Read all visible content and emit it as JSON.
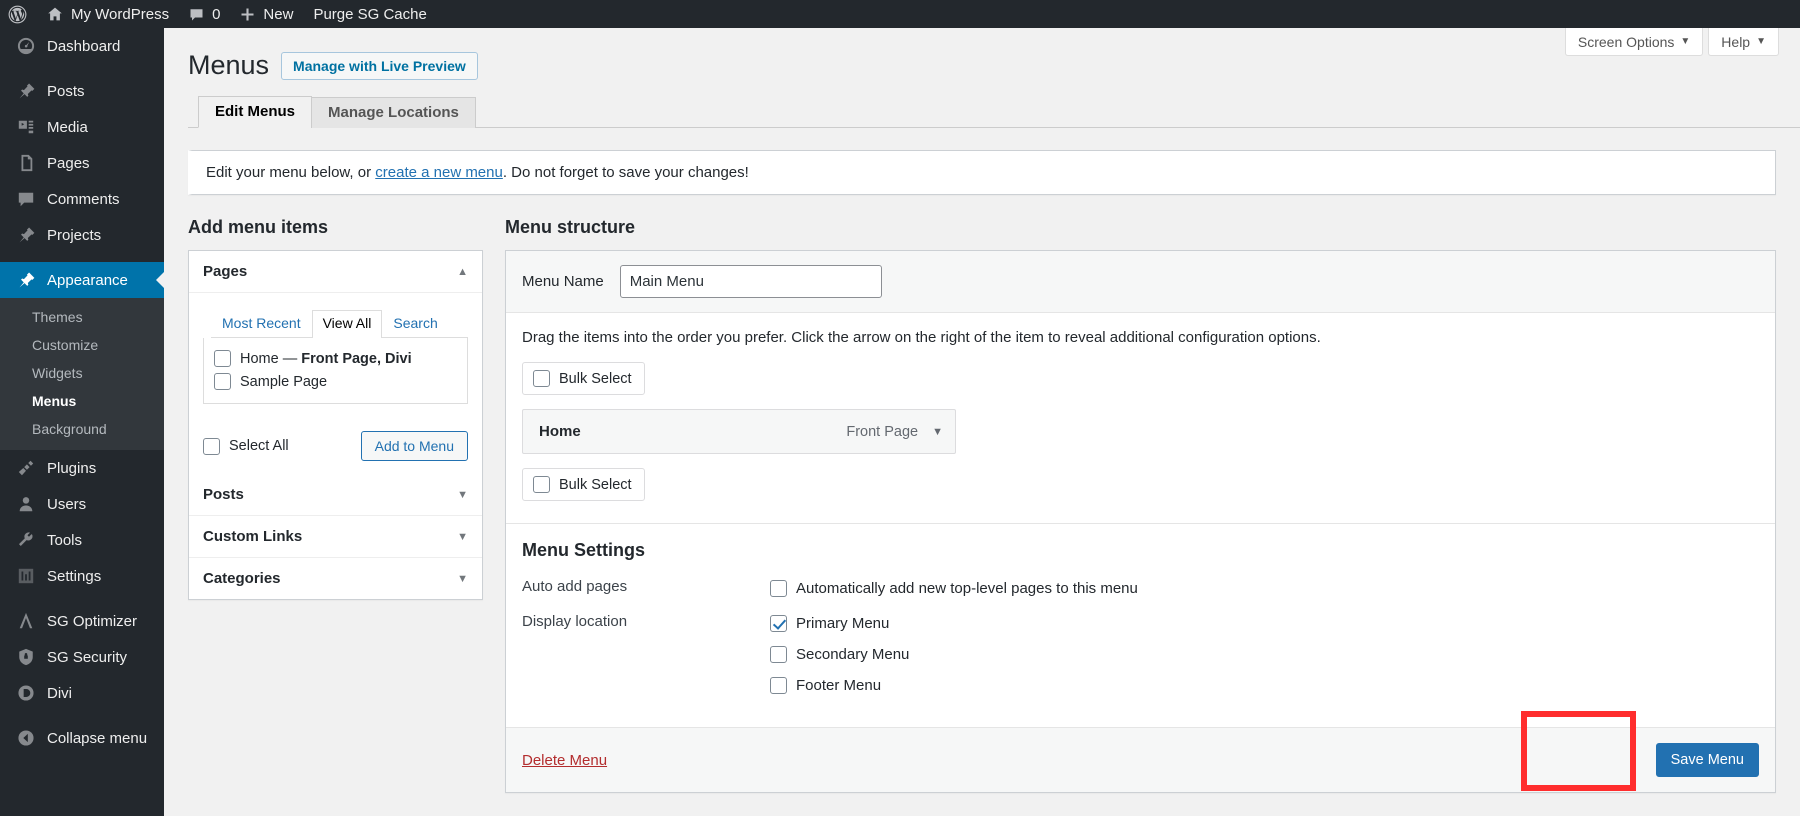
{
  "adminbar": {
    "items": [
      {
        "icon": "wordpress-logo-icon",
        "label": ""
      },
      {
        "icon": "home-icon",
        "label": "My WordPress"
      },
      {
        "icon": "comment-bubble-icon",
        "label": "0"
      },
      {
        "icon": "plus-icon",
        "label": "New"
      },
      {
        "icon": "",
        "label": "Purge SG Cache"
      }
    ]
  },
  "sidebar": {
    "items": [
      {
        "label": "Dashboard",
        "icon": "dashboard-icon",
        "current": false,
        "separator": false
      },
      {
        "label": "Posts",
        "icon": "pin-icon",
        "current": false,
        "separator": true
      },
      {
        "label": "Media",
        "icon": "media-icon",
        "current": false,
        "separator": false
      },
      {
        "label": "Pages",
        "icon": "pages-icon",
        "current": false,
        "separator": false
      },
      {
        "label": "Comments",
        "icon": "comment-bubble-icon",
        "current": false,
        "separator": false
      },
      {
        "label": "Projects",
        "icon": "pin-icon",
        "current": false,
        "separator": false
      },
      {
        "label": "Appearance",
        "icon": "paintbrush-icon",
        "current": true,
        "separator": true
      },
      {
        "label": "Plugins",
        "icon": "plug-icon",
        "current": false,
        "separator": false
      },
      {
        "label": "Users",
        "icon": "user-icon",
        "current": false,
        "separator": false
      },
      {
        "label": "Tools",
        "icon": "wrench-icon",
        "current": false,
        "separator": false
      },
      {
        "label": "Settings",
        "icon": "settings-sliders-icon",
        "current": false,
        "separator": false
      },
      {
        "label": "SG Optimizer",
        "icon": "sg-optimizer-icon",
        "current": false,
        "separator": true
      },
      {
        "label": "SG Security",
        "icon": "sg-security-icon",
        "current": false,
        "separator": false
      },
      {
        "label": "Divi",
        "icon": "divi-icon",
        "current": false,
        "separator": false
      },
      {
        "label": "Collapse menu",
        "icon": "collapse-arrow-icon",
        "current": false,
        "separator": true
      }
    ],
    "submenu": {
      "items": [
        {
          "label": "Themes",
          "active": false
        },
        {
          "label": "Customize",
          "active": false
        },
        {
          "label": "Widgets",
          "active": false
        },
        {
          "label": "Menus",
          "active": true
        },
        {
          "label": "Background",
          "active": false
        }
      ]
    }
  },
  "screen_meta": {
    "screen_options": "Screen Options",
    "help": "Help",
    "caret": "▼"
  },
  "header": {
    "title": "Menus",
    "live_preview_button": "Manage with Live Preview"
  },
  "tabs": [
    {
      "label": "Edit Menus",
      "active": true
    },
    {
      "label": "Manage Locations",
      "active": false
    }
  ],
  "notice": {
    "prefix": "Edit your menu below, or ",
    "link": "create a new menu",
    "suffix": ". Do not forget to save your changes!"
  },
  "add_menu_items": {
    "title": "Add menu items",
    "pages_panel": {
      "heading": "Pages",
      "toggle_icon": "chevron-up-icon",
      "toggle_glyph": "▲",
      "tabs": [
        {
          "label": "Most Recent",
          "selected": false
        },
        {
          "label": "View All",
          "selected": true
        },
        {
          "label": "Search",
          "selected": false
        }
      ],
      "items": [
        {
          "label": "Home",
          "suffix": " — ",
          "bold_suffix": "Front Page, Divi",
          "checked": false
        },
        {
          "label": "Sample Page",
          "suffix": "",
          "bold_suffix": "",
          "checked": false
        }
      ],
      "select_all_label": "Select All",
      "select_all_checked": false,
      "add_button": "Add to Menu"
    },
    "collapsed_panels": [
      {
        "heading": "Posts",
        "toggle_glyph": "▼"
      },
      {
        "heading": "Custom Links",
        "toggle_glyph": "▼"
      },
      {
        "heading": "Categories",
        "toggle_glyph": "▼"
      }
    ]
  },
  "menu_structure": {
    "title": "Menu structure",
    "menu_name_label": "Menu Name",
    "menu_name_value": "Main Menu",
    "menu_name_placeholder": "Menu Name",
    "drag_hint": "Drag the items into the order you prefer. Click the arrow on the right of the item to reveal additional configuration options.",
    "bulk_select_top": "Bulk Select",
    "bulk_select_top_checked": false,
    "bulk_select_bottom": "Bulk Select",
    "bulk_select_bottom_checked": false,
    "items": [
      {
        "title": "Home",
        "type": "Front Page",
        "toggle_glyph": "▼"
      }
    ],
    "settings": {
      "title": "Menu Settings",
      "auto_add_label": "Auto add pages",
      "auto_add_option": "Automatically add new top-level pages to this menu",
      "auto_add_checked": false,
      "display_location_label": "Display location",
      "locations": [
        {
          "label": "Primary Menu",
          "checked": true
        },
        {
          "label": "Secondary Menu",
          "checked": false
        },
        {
          "label": "Footer Menu",
          "checked": false
        }
      ]
    },
    "footer": {
      "delete_label": "Delete Menu",
      "save_label": "Save Menu"
    }
  },
  "colors": {
    "admin_bar": "#23282d",
    "sidebar": "#23282d",
    "submenu": "#32373c",
    "current_menu": "#0073aa",
    "accent_link": "#2271b1",
    "primary_button": "#2271b1",
    "delete_link": "#b32d2e",
    "highlight_box": "#ff2d2d",
    "page_background": "#f1f1f1"
  },
  "annotation": {
    "highlight_target": "save-menu-button"
  }
}
